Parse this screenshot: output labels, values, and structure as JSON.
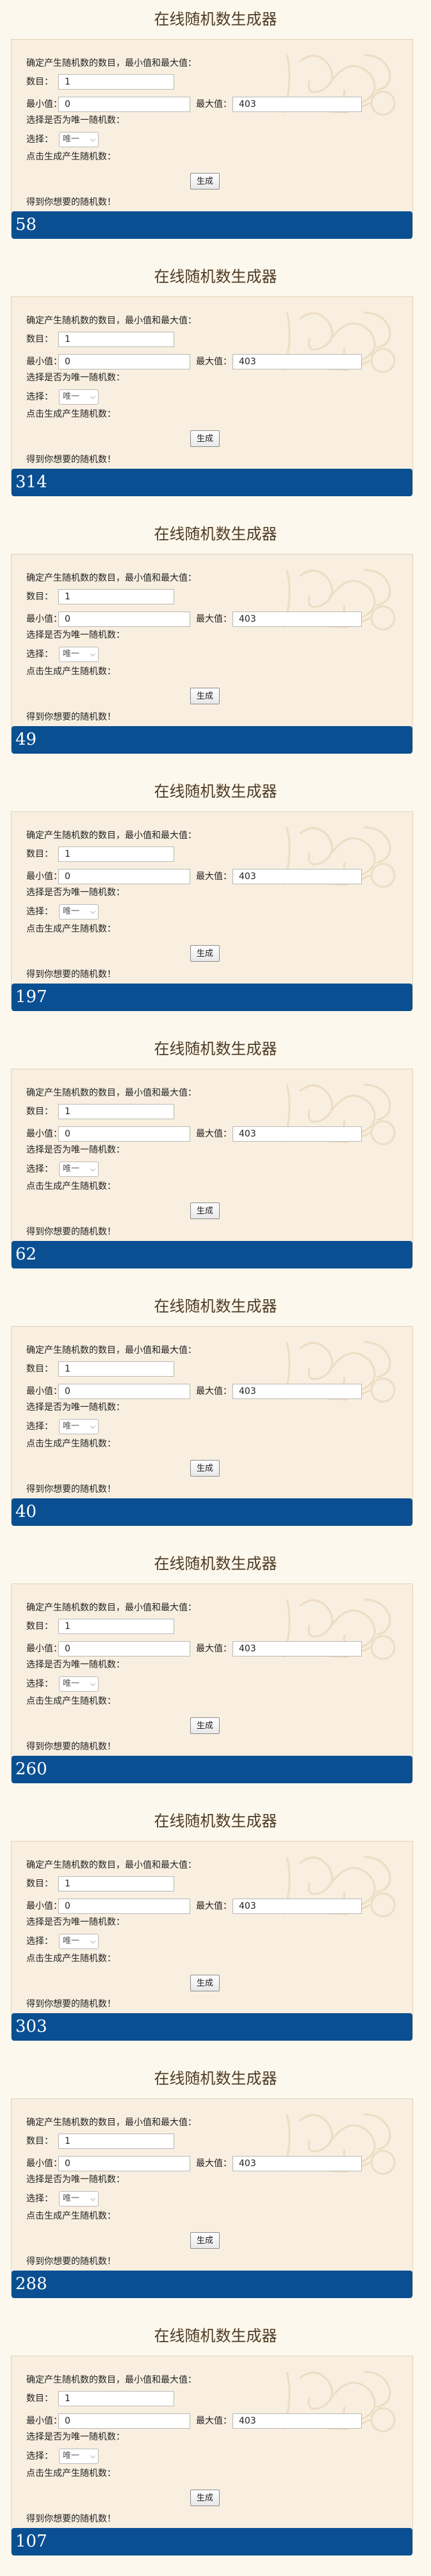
{
  "generators": [
    {
      "title": "在线随机数生成器",
      "instruction": "确定产生随机数的数目，最小值和最大值：",
      "count_label": "数目：",
      "count_value": "1",
      "min_label": "最小值：",
      "min_value": "0",
      "max_label": "最大值：",
      "max_value": "403",
      "unique_prompt": "选择是否为唯一随机数：",
      "select_label": "选择：",
      "select_value": "唯一",
      "click_prompt": "点击生成产生随机数：",
      "generate_label": "生成",
      "result_label": "得到你想要的随机数！",
      "result_value": "58"
    },
    {
      "title": "在线随机数生成器",
      "instruction": "确定产生随机数的数目，最小值和最大值：",
      "count_label": "数目：",
      "count_value": "1",
      "min_label": "最小值：",
      "min_value": "0",
      "max_label": "最大值：",
      "max_value": "403",
      "unique_prompt": "选择是否为唯一随机数：",
      "select_label": "选择：",
      "select_value": "唯一",
      "click_prompt": "点击生成产生随机数：",
      "generate_label": "生成",
      "result_label": "得到你想要的随机数！",
      "result_value": "314"
    },
    {
      "title": "在线随机数生成器",
      "instruction": "确定产生随机数的数目，最小值和最大值：",
      "count_label": "数目：",
      "count_value": "1",
      "min_label": "最小值：",
      "min_value": "0",
      "max_label": "最大值：",
      "max_value": "403",
      "unique_prompt": "选择是否为唯一随机数：",
      "select_label": "选择：",
      "select_value": "唯一",
      "click_prompt": "点击生成产生随机数：",
      "generate_label": "生成",
      "result_label": "得到你想要的随机数！",
      "result_value": "49"
    },
    {
      "title": "在线随机数生成器",
      "instruction": "确定产生随机数的数目，最小值和最大值：",
      "count_label": "数目：",
      "count_value": "1",
      "min_label": "最小值：",
      "min_value": "0",
      "max_label": "最大值：",
      "max_value": "403",
      "unique_prompt": "选择是否为唯一随机数：",
      "select_label": "选择：",
      "select_value": "唯一",
      "click_prompt": "点击生成产生随机数：",
      "generate_label": "生成",
      "result_label": "得到你想要的随机数！",
      "result_value": "197"
    },
    {
      "title": "在线随机数生成器",
      "instruction": "确定产生随机数的数目，最小值和最大值：",
      "count_label": "数目：",
      "count_value": "1",
      "min_label": "最小值：",
      "min_value": "0",
      "max_label": "最大值：",
      "max_value": "403",
      "unique_prompt": "选择是否为唯一随机数：",
      "select_label": "选择：",
      "select_value": "唯一",
      "click_prompt": "点击生成产生随机数：",
      "generate_label": "生成",
      "result_label": "得到你想要的随机数！",
      "result_value": "62"
    },
    {
      "title": "在线随机数生成器",
      "instruction": "确定产生随机数的数目，最小值和最大值：",
      "count_label": "数目：",
      "count_value": "1",
      "min_label": "最小值：",
      "min_value": "0",
      "max_label": "最大值：",
      "max_value": "403",
      "unique_prompt": "选择是否为唯一随机数：",
      "select_label": "选择：",
      "select_value": "唯一",
      "click_prompt": "点击生成产生随机数：",
      "generate_label": "生成",
      "result_label": "得到你想要的随机数！",
      "result_value": "40"
    },
    {
      "title": "在线随机数生成器",
      "instruction": "确定产生随机数的数目，最小值和最大值：",
      "count_label": "数目：",
      "count_value": "1",
      "min_label": "最小值：",
      "min_value": "0",
      "max_label": "最大值：",
      "max_value": "403",
      "unique_prompt": "选择是否为唯一随机数：",
      "select_label": "选择：",
      "select_value": "唯一",
      "click_prompt": "点击生成产生随机数：",
      "generate_label": "生成",
      "result_label": "得到你想要的随机数！",
      "result_value": "260"
    },
    {
      "title": "在线随机数生成器",
      "instruction": "确定产生随机数的数目，最小值和最大值：",
      "count_label": "数目：",
      "count_value": "1",
      "min_label": "最小值：",
      "min_value": "0",
      "max_label": "最大值：",
      "max_value": "403",
      "unique_prompt": "选择是否为唯一随机数：",
      "select_label": "选择：",
      "select_value": "唯一",
      "click_prompt": "点击生成产生随机数：",
      "generate_label": "生成",
      "result_label": "得到你想要的随机数！",
      "result_value": "303"
    },
    {
      "title": "在线随机数生成器",
      "instruction": "确定产生随机数的数目，最小值和最大值：",
      "count_label": "数目：",
      "count_value": "1",
      "min_label": "最小值：",
      "min_value": "0",
      "max_label": "最大值：",
      "max_value": "403",
      "unique_prompt": "选择是否为唯一随机数：",
      "select_label": "选择：",
      "select_value": "唯一",
      "click_prompt": "点击生成产生随机数：",
      "generate_label": "生成",
      "result_label": "得到你想要的随机数！",
      "result_value": "288"
    },
    {
      "title": "在线随机数生成器",
      "instruction": "确定产生随机数的数目，最小值和最大值：",
      "count_label": "数目：",
      "count_value": "1",
      "min_label": "最小值：",
      "min_value": "0",
      "max_label": "最大值：",
      "max_value": "403",
      "unique_prompt": "选择是否为唯一随机数：",
      "select_label": "选择：",
      "select_value": "唯一",
      "click_prompt": "点击生成产生随机数：",
      "generate_label": "生成",
      "result_label": "得到你想要的随机数！",
      "result_value": "107"
    }
  ]
}
